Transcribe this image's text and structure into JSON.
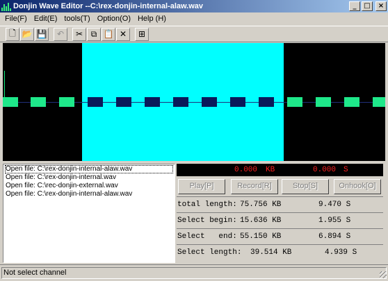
{
  "window": {
    "title": "Donjin Wave Editor --C:\\rex-donjin-internal-alaw.wav",
    "minimize": "_",
    "maximize": "□",
    "close": "×"
  },
  "menu": [
    "File(F)",
    "Edit(E)",
    "tools(T)",
    "Option(O)",
    "Help (H)"
  ],
  "toolbar": {
    "new": "🗋",
    "open": "📂",
    "save": "💾",
    "undo": "↶",
    "cut": "✂",
    "copy": "⧉",
    "paste": "📋",
    "delete": "✕",
    "channel": "⊞"
  },
  "log": [
    "Open file: C:\\rex-donjin-internal-alaw.wav",
    "Open file: C:\\rex-donjin-internal.wav",
    "Open file: C:\\rec-donjin-external.wav",
    "Open file: C:\\rex-donjin-internal-alaw.wav"
  ],
  "readout": {
    "size": "0.000",
    "size_unit": "KB",
    "time": "0.000",
    "time_unit": "S"
  },
  "controls": {
    "play": "Play[P]",
    "record": "Record[R]",
    "stop": "Stop[S]",
    "onhook": "Onhook[O]"
  },
  "info": {
    "total": {
      "label": "total length:",
      "kb": "75.756 KB",
      "s": "9.470 S"
    },
    "begin": {
      "label": "Select begin:",
      "kb": "15.636 KB",
      "s": "1.955 S"
    },
    "end": {
      "label": "Select   end:",
      "kb": "55.150 KB",
      "s": "6.894 S"
    },
    "length": {
      "label": "Select length:",
      "kb": "39.514 KB",
      "s": "4.939 S"
    }
  },
  "status": "Not select channel",
  "colors": {
    "wave_unselected": "#1ee88a",
    "wave_selected": "#0a1a5a",
    "selection": "#00ffff",
    "readout_text": "#ff2020"
  }
}
